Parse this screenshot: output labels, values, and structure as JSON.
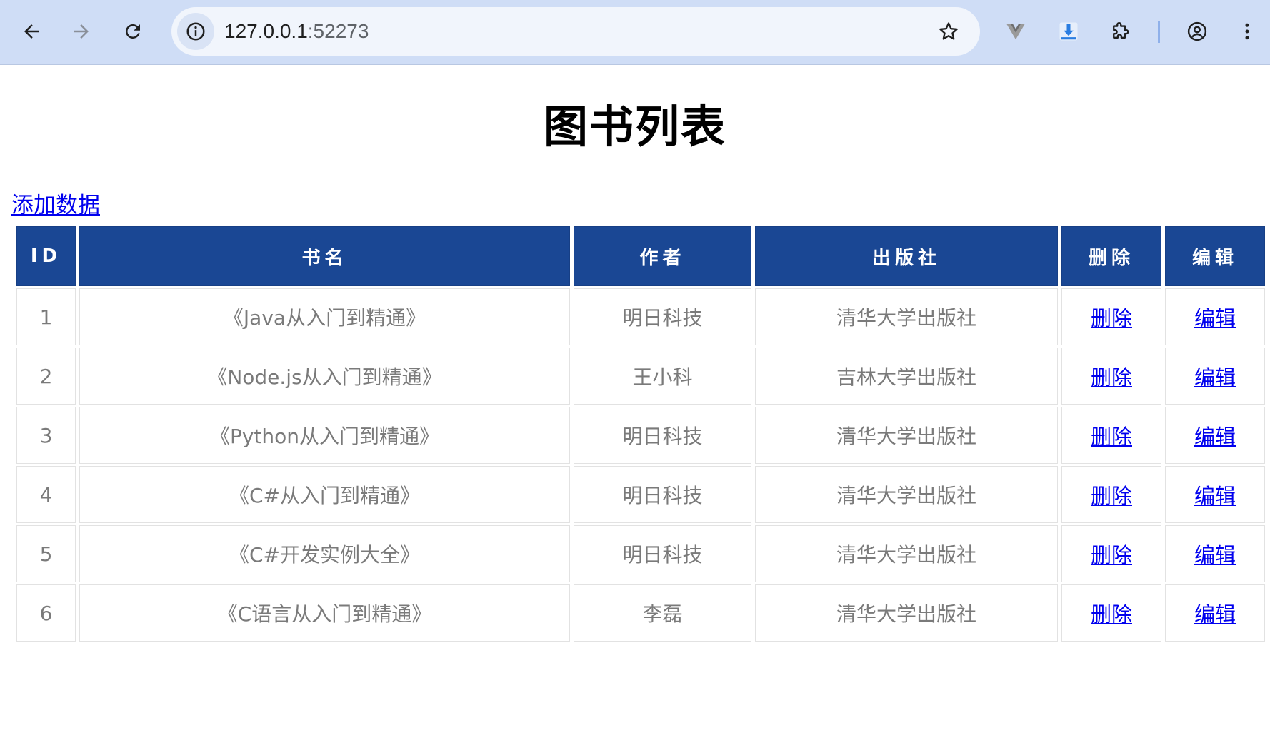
{
  "browser": {
    "url_host": "127.0.0.1",
    "url_port": ":52273"
  },
  "page": {
    "title": "图书列表",
    "add_link": "添加数据"
  },
  "table": {
    "headers": [
      "ID",
      "书名",
      "作者",
      "出版社",
      "删除",
      "编辑"
    ],
    "rows": [
      {
        "id": "1",
        "name": "《Java从入门到精通》",
        "author": "明日科技",
        "publisher": "清华大学出版社",
        "delete": "删除",
        "edit": "编辑"
      },
      {
        "id": "2",
        "name": "《Node.js从入门到精通》",
        "author": "王小科",
        "publisher": "吉林大学出版社",
        "delete": "删除",
        "edit": "编辑"
      },
      {
        "id": "3",
        "name": "《Python从入门到精通》",
        "author": "明日科技",
        "publisher": "清华大学出版社",
        "delete": "删除",
        "edit": "编辑"
      },
      {
        "id": "4",
        "name": "《C#从入门到精通》",
        "author": "明日科技",
        "publisher": "清华大学出版社",
        "delete": "删除",
        "edit": "编辑"
      },
      {
        "id": "5",
        "name": "《C#开发实例大全》",
        "author": "明日科技",
        "publisher": "清华大学出版社",
        "delete": "删除",
        "edit": "编辑"
      },
      {
        "id": "6",
        "name": "《C语言从入门到精通》",
        "author": "李磊",
        "publisher": "清华大学出版社",
        "delete": "删除",
        "edit": "编辑"
      }
    ]
  },
  "colors": {
    "header_bg": "#1a4794",
    "link": "#0000ee",
    "chrome_bg": "#cfddf6"
  },
  "icons": [
    "back-arrow-icon",
    "forward-arrow-icon",
    "reload-icon",
    "site-info-icon",
    "bookmark-star-icon",
    "vue-devtools-icon",
    "download-icon",
    "extensions-icon",
    "profile-icon",
    "menu-dots-icon"
  ]
}
